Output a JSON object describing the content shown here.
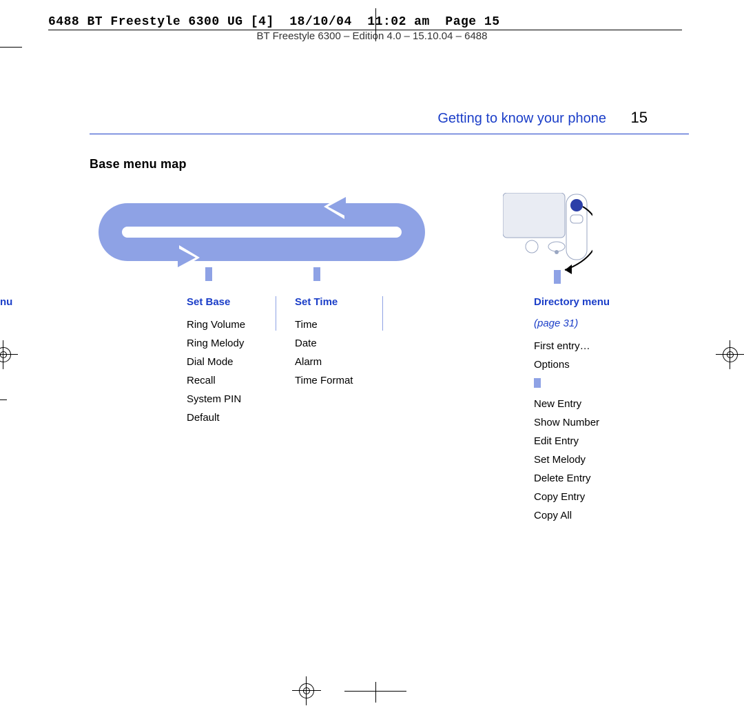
{
  "slug": "6488 BT Freestyle 6300 UG [4]  18/10/04  11:02 am  Page 15",
  "running_head": "BT Freestyle 6300 – Edition 4.0 – 15.10.04 – 6488",
  "chapter_title": "Getting to know your phone",
  "page_number": "15",
  "section_heading": "Base menu map",
  "partial_menu_label": "nu",
  "set_base": {
    "title": "Set Base",
    "items": [
      "Ring Volume",
      "Ring Melody",
      "Dial Mode",
      "Recall",
      "System PIN",
      "Default"
    ]
  },
  "set_time": {
    "title": "Set Time",
    "items": [
      "Time",
      "Date",
      "Alarm",
      "Time Format"
    ]
  },
  "directory": {
    "title": "Directory menu",
    "page_ref": "(page 31)",
    "first_items": [
      "First entry…",
      "Options"
    ],
    "sub_items": [
      "New Entry",
      "Show Number",
      "Edit Entry",
      "Set Melody",
      "Delete Entry",
      "Copy Entry",
      "Copy All"
    ]
  }
}
